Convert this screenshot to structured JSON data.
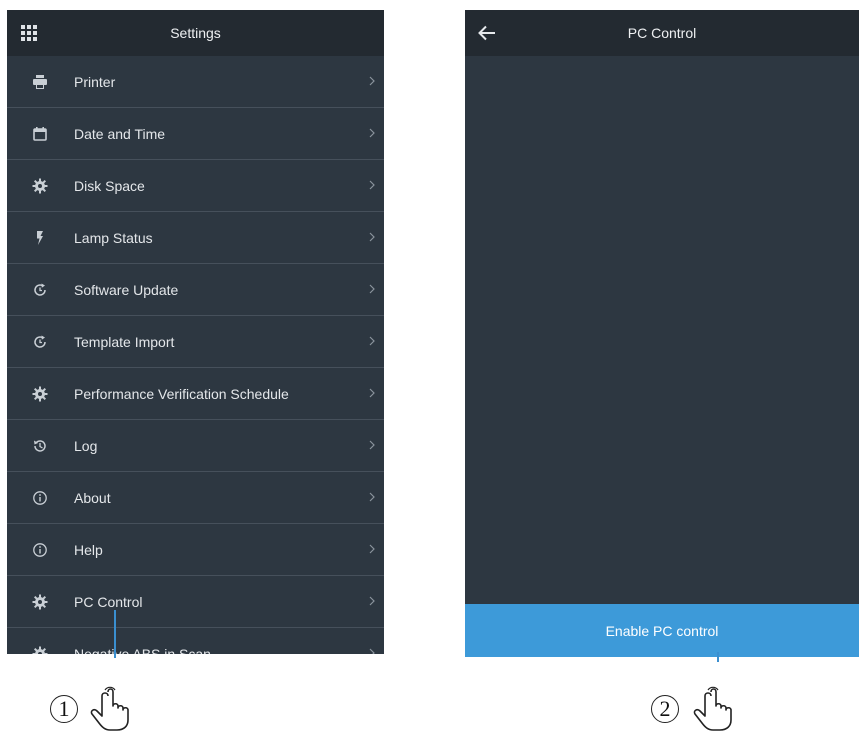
{
  "settings_screen": {
    "title": "Settings",
    "apps_icon": "grid-icon",
    "items": [
      {
        "label": "Printer",
        "icon": "printer-icon"
      },
      {
        "label": "Date and Time",
        "icon": "calendar-icon"
      },
      {
        "label": "Disk Space",
        "icon": "gear-icon"
      },
      {
        "label": "Lamp Status",
        "icon": "bolt-icon"
      },
      {
        "label": "Software Update",
        "icon": "refresh-icon"
      },
      {
        "label": "Template Import",
        "icon": "refresh-icon"
      },
      {
        "label": "Performance Verification Schedule",
        "icon": "gear-icon"
      },
      {
        "label": "Log",
        "icon": "history-icon"
      },
      {
        "label": "About",
        "icon": "info-icon"
      },
      {
        "label": "Help",
        "icon": "info-icon"
      },
      {
        "label": "PC Control",
        "icon": "gear-icon"
      },
      {
        "label": "Negative ABS in Scan",
        "icon": "gear-icon"
      }
    ],
    "chevron": "›"
  },
  "pc_control_screen": {
    "title": "PC Control",
    "back_icon": "back-arrow-icon",
    "enable_button": "Enable PC control"
  },
  "callouts": {
    "step1": "1",
    "step2": "2"
  },
  "colors": {
    "panel_bg": "#2d3741",
    "titlebar_bg": "#232a31",
    "accent": "#3d9ad9"
  }
}
